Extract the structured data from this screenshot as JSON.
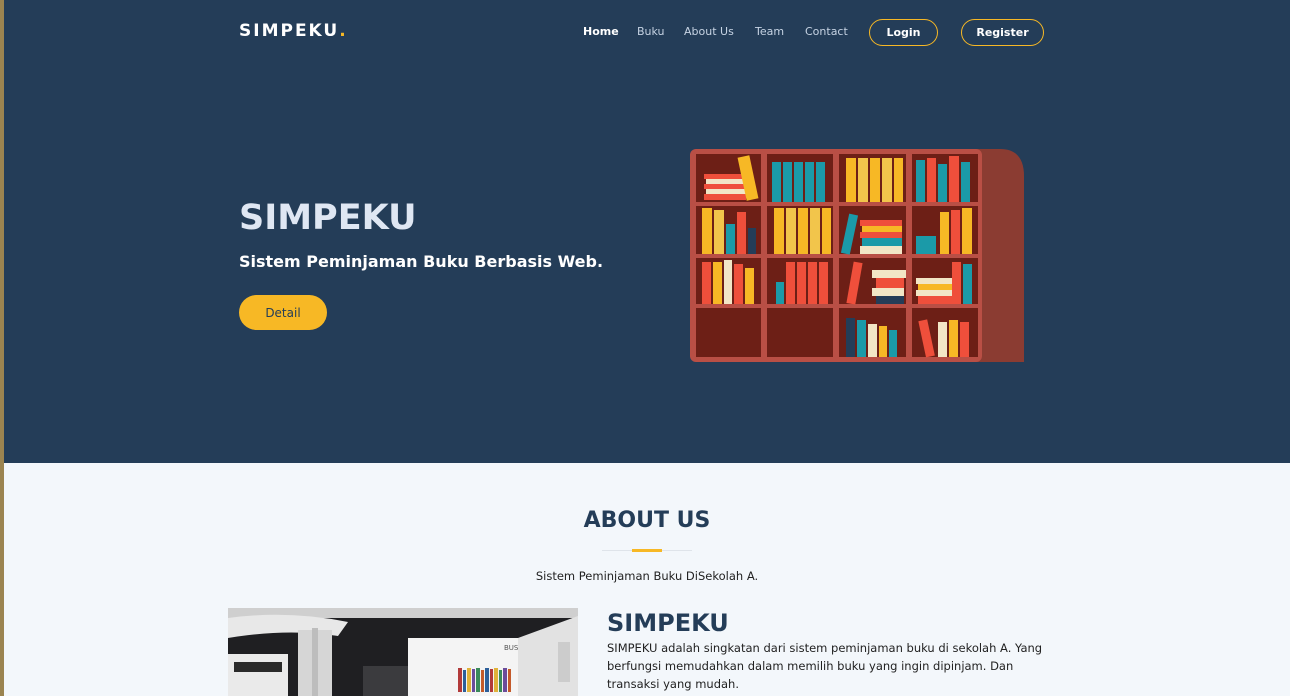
{
  "brand": {
    "name": "SIMPEKU",
    "dot": ".",
    "accent_color": "#f7b825",
    "primary_color": "#243d58"
  },
  "nav": {
    "items": [
      "Home",
      "Buku",
      "About Us",
      "Team",
      "Contact"
    ],
    "active": "Home",
    "login_label": "Login",
    "register_label": "Register"
  },
  "hero": {
    "title": "SIMPEKU",
    "subtitle": "Sistem Peminjaman Buku Berbasis Web.",
    "button_label": "Detail",
    "illustration": "bookshelf-illustration"
  },
  "about": {
    "title": "ABOUT US",
    "description": "Sistem Peminjaman Buku DiSekolah A.",
    "photo_sign": "BUSINESS",
    "heading": "SIMPEKU",
    "body": "SIMPEKU adalah singkatan dari sistem peminjaman buku di sekolah A. Yang berfungsi memudahkan dalam memilih buku yang ingin dipinjam. Dan transaksi yang mudah."
  }
}
